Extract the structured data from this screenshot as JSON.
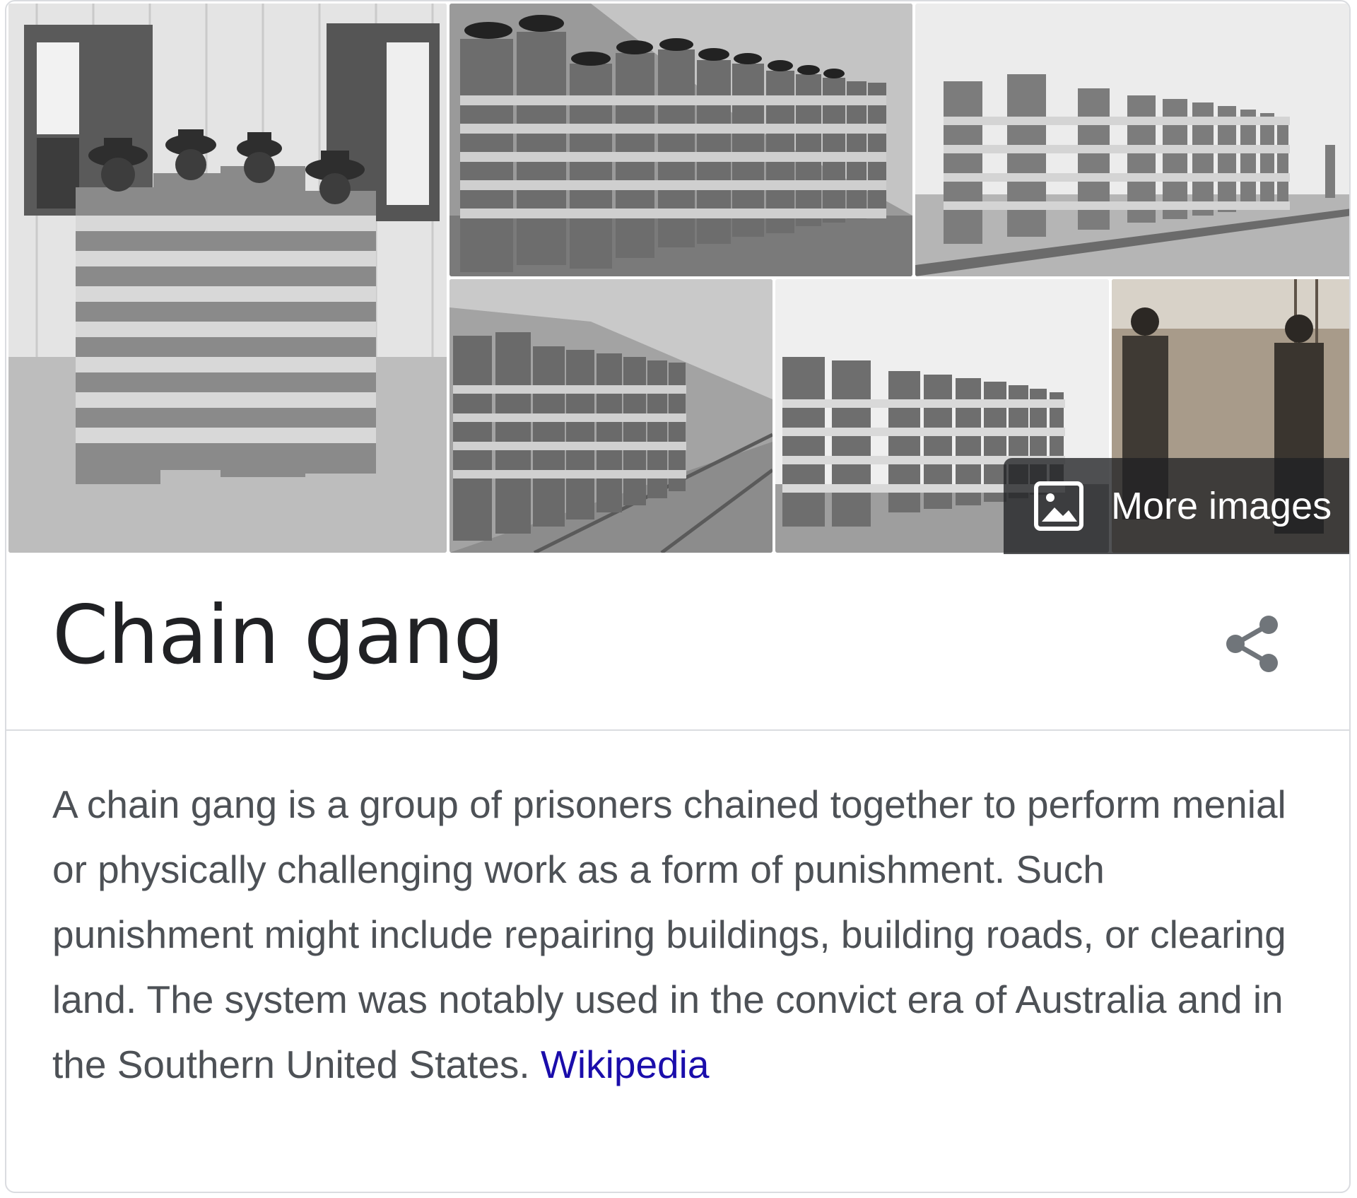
{
  "knowledge_panel": {
    "title": "Chain gang",
    "description": "A chain gang is a group of prisoners chained together to perform menial or physically challenging work as a form of punishment. Such punishment might include repairing buildings, building roads, or clearing land. The system was notably used in the convict era of Australia and in the Southern United States.",
    "source_link": "Wikipedia",
    "more_images_label": "More images",
    "share_icon": "share-icon",
    "image_icon": "image-icon"
  },
  "colors": {
    "title": "#202124",
    "description": "#4d5156",
    "link": "#1a0dab",
    "border": "#dadce0",
    "overlay": "#202124"
  }
}
